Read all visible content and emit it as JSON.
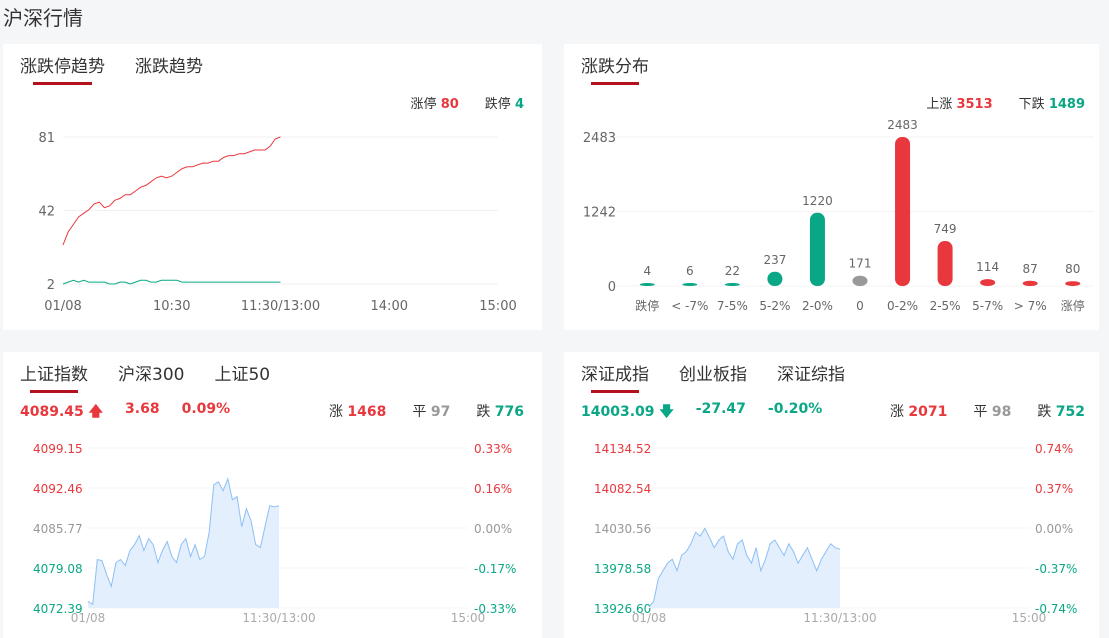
{
  "page_title": "沪深行情",
  "colors": {
    "red": "#e8383d",
    "green": "#0aa786",
    "grey": "#999999",
    "line_blue": "#8dbff5",
    "area_blue": "#e3effd"
  },
  "limit_panel": {
    "tabs": [
      {
        "label": "涨跌停趋势",
        "active": true
      },
      {
        "label": "涨跌趋势",
        "active": false
      }
    ],
    "legend": {
      "up_label": "涨停",
      "up_value": "80",
      "down_label": "跌停",
      "down_value": "4"
    },
    "y_ticks": [
      "81",
      "42",
      "2"
    ],
    "x_ticks": [
      "01/08",
      "10:30",
      "11:30/13:00",
      "14:00",
      "15:00"
    ],
    "y_range": [
      2,
      81
    ],
    "up_series": [
      23,
      30,
      34,
      38,
      40,
      42,
      45,
      46,
      43,
      44,
      47,
      48,
      50,
      50,
      52,
      54,
      55,
      57,
      59,
      60,
      59,
      60,
      62,
      64,
      65,
      65,
      66,
      67,
      67,
      68,
      68,
      70,
      71,
      71,
      72,
      72,
      73,
      74,
      74,
      74,
      76,
      80,
      81
    ],
    "down_series": [
      2,
      3,
      4,
      3,
      4,
      3,
      3,
      3,
      3,
      2,
      2,
      3,
      3,
      2,
      3,
      4,
      4,
      3,
      3,
      4,
      4,
      4,
      4,
      3,
      3,
      3,
      3,
      3,
      3,
      3,
      3,
      3,
      3,
      3,
      3,
      3,
      3,
      3,
      3,
      3,
      3,
      3,
      3
    ]
  },
  "dist_panel": {
    "tabs": [
      {
        "label": "涨跌分布",
        "active": true
      }
    ],
    "legend": {
      "up_label": "上涨",
      "up_value": "3513",
      "down_label": "下跌",
      "down_value": "1489"
    },
    "chart_data": {
      "type": "bar",
      "categories": [
        "跌停",
        "< -7%",
        "7-5%",
        "5-2%",
        "2-0%",
        "0",
        "0-2%",
        "2-5%",
        "5-7%",
        "> 7%",
        "涨停"
      ],
      "values": [
        4,
        6,
        22,
        237,
        1220,
        171,
        2483,
        749,
        114,
        87,
        80
      ],
      "color_groups": [
        "green",
        "green",
        "green",
        "green",
        "green",
        "grey",
        "red",
        "red",
        "red",
        "red",
        "red"
      ],
      "y_ticks": [
        "2483",
        "1242",
        "0"
      ],
      "ylim": [
        0,
        2483
      ]
    }
  },
  "sh_panel": {
    "tabs": [
      {
        "label": "上证指数",
        "active": true
      },
      {
        "label": "沪深300",
        "active": false
      },
      {
        "label": "上证50",
        "active": false
      }
    ],
    "price": "4089.45",
    "change": "3.68",
    "change_pct": "0.09%",
    "direction": "up",
    "stats": {
      "up_label": "涨",
      "up": "1468",
      "flat_label": "平",
      "flat": "97",
      "down_label": "跌",
      "down": "776"
    },
    "y_left": [
      "4099.15",
      "4092.46",
      "4085.77",
      "4079.08",
      "4072.39"
    ],
    "y_right": [
      "0.33%",
      "0.16%",
      "0.00%",
      "-0.17%",
      "-0.33%"
    ],
    "x_ticks": [
      "01/08",
      "11:30/13:00",
      "15:00"
    ],
    "y_range": [
      4072.39,
      4099.15
    ],
    "series": [
      4073.5,
      4073,
      4080.5,
      4080.3,
      4078,
      4076,
      4080,
      4080.5,
      4079.5,
      4082,
      4083,
      4084.5,
      4082,
      4084,
      4083,
      4080,
      4082,
      4083.5,
      4081,
      4080,
      4083,
      4084,
      4081,
      4083,
      4080.5,
      4081,
      4085,
      4093,
      4093.5,
      4092,
      4094,
      4090.5,
      4091,
      4086,
      4089,
      4087,
      4083,
      4082.5,
      4086,
      4089.5,
      4089.3,
      4089.5
    ]
  },
  "sz_panel": {
    "tabs": [
      {
        "label": "深证成指",
        "active": true
      },
      {
        "label": "创业板指",
        "active": false
      },
      {
        "label": "深证综指",
        "active": false
      }
    ],
    "price": "14003.09",
    "change": "-27.47",
    "change_pct": "-0.20%",
    "direction": "down",
    "stats": {
      "up_label": "涨",
      "up": "2071",
      "flat_label": "平",
      "flat": "98",
      "down_label": "跌",
      "down": "752"
    },
    "y_left": [
      "14134.52",
      "14082.54",
      "14030.56",
      "13978.58",
      "13926.60"
    ],
    "y_right": [
      "0.74%",
      "0.37%",
      "0.00%",
      "-0.37%",
      "-0.74%"
    ],
    "x_ticks": [
      "01/08",
      "11:30/13:00",
      "15:00"
    ],
    "y_range": [
      13926.6,
      14134.52
    ],
    "series": [
      13928,
      13935,
      13965,
      13975,
      13985,
      13990,
      13975,
      13995,
      14000,
      14010,
      14025,
      14020,
      14030,
      14018,
      14005,
      14015,
      14020,
      14000,
      13990,
      14010,
      14015,
      13995,
      13985,
      14005,
      13975,
      13990,
      14010,
      14015,
      14005,
      13995,
      14010,
      14000,
      13985,
      13995,
      14005,
      13990,
      13975,
      13990,
      14000,
      14010,
      14005,
      14003
    ]
  }
}
